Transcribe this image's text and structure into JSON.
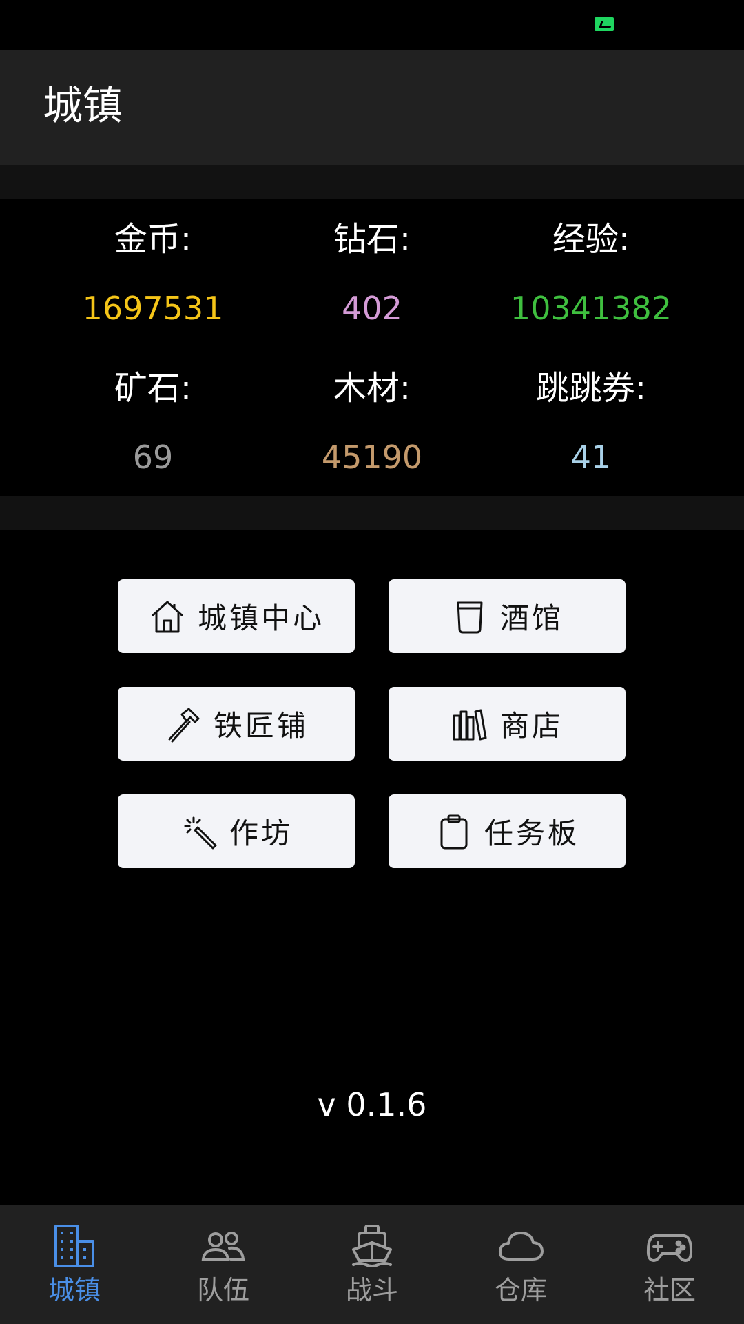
{
  "app_bar": {
    "title": "城镇"
  },
  "stats": [
    {
      "label": "金币:",
      "value": "1697531",
      "color": "#f5c518"
    },
    {
      "label": "钻石:",
      "value": "402",
      "color": "#d49bd6"
    },
    {
      "label": "经验:",
      "value": "10341382",
      "color": "#3fbf3f"
    },
    {
      "label": "矿石:",
      "value": "69",
      "color": "#9a9a9a"
    },
    {
      "label": "木材:",
      "value": "45190",
      "color": "#c49a6c"
    },
    {
      "label": "跳跳券:",
      "value": "41",
      "color": "#a9d1e8"
    }
  ],
  "buttons": [
    {
      "label": "城镇中心",
      "icon": "house-icon"
    },
    {
      "label": "酒馆",
      "icon": "cup-icon"
    },
    {
      "label": "铁匠铺",
      "icon": "hammer-icon"
    },
    {
      "label": "商店",
      "icon": "books-icon"
    },
    {
      "label": "作坊",
      "icon": "magic-wand-icon"
    },
    {
      "label": "任务板",
      "icon": "clipboard-icon"
    }
  ],
  "version": "v 0.1.6",
  "bottom_nav": [
    {
      "label": "城镇",
      "icon": "buildings-icon",
      "active": true
    },
    {
      "label": "队伍",
      "icon": "people-icon",
      "active": false
    },
    {
      "label": "战斗",
      "icon": "ship-icon",
      "active": false
    },
    {
      "label": "仓库",
      "icon": "cloud-icon",
      "active": false
    },
    {
      "label": "社区",
      "icon": "gamepad-icon",
      "active": false
    }
  ],
  "colors": {
    "accent": "#4a8fe7",
    "nav_inactive": "#9e9e9e",
    "button_bg": "#f3f4f8",
    "status_icon": "#1fd660"
  }
}
